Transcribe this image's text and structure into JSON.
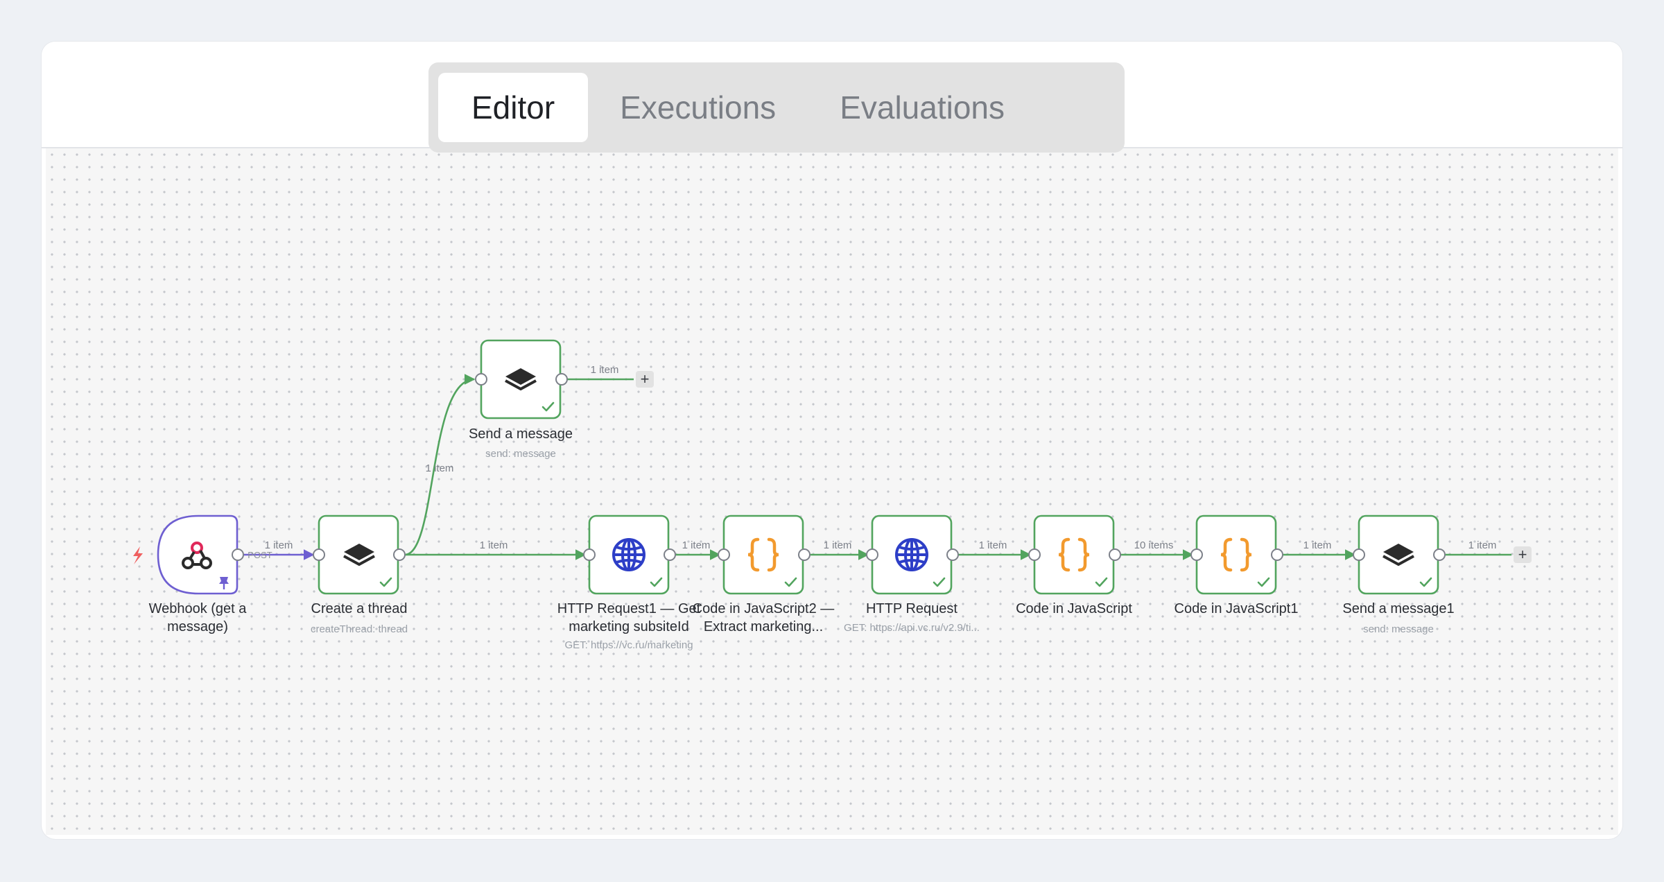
{
  "tabs": [
    {
      "label": "Editor",
      "active": true
    },
    {
      "label": "Executions",
      "active": false
    },
    {
      "label": "Evaluations",
      "active": false
    }
  ],
  "colors": {
    "edge": "#52a45e",
    "trigger_edge": "#6e5fd1",
    "code_icon": "#f29a2e",
    "http_icon": "#2d3ec7",
    "webhook_icon": "#e0295a"
  },
  "nodes": {
    "webhook": {
      "label_1": "Webhook (get a",
      "label_2": "message)",
      "icon": "webhook-icon",
      "method": "POST"
    },
    "create_thread": {
      "label": "Create a thread",
      "sub": "createThread: thread",
      "icon": "layers-icon"
    },
    "send_message": {
      "label": "Send a message",
      "sub": "send: message",
      "icon": "layers-icon"
    },
    "http_request1": {
      "label_1": "HTTP Request1 — Get",
      "label_2": "marketing subsiteId",
      "sub": "GET: https://vc.ru/marketing",
      "icon": "globe-icon"
    },
    "code_js2": {
      "label_1": "Code in JavaScript2 —",
      "label_2": "Extract marketing...",
      "icon": "code-braces-icon"
    },
    "http_request": {
      "label": "HTTP Request",
      "sub": "GET: https://api.vc.ru/v2.9/ti...",
      "icon": "globe-icon"
    },
    "code_js": {
      "label": "Code in JavaScript",
      "icon": "code-braces-icon"
    },
    "code_js1": {
      "label": "Code in JavaScript1",
      "icon": "code-braces-icon"
    },
    "send_message1": {
      "label": "Send a message1",
      "sub": "send: message",
      "icon": "layers-icon"
    }
  },
  "edges": {
    "webhook_create": "1 item",
    "create_send": "1 item",
    "send_out": "1 item",
    "create_http1": "1 item",
    "http1_code2": "1 item",
    "code2_http": "1 item",
    "http_code": "1 item",
    "code_code1": "10 items",
    "code1_send1": "1 item",
    "send1_out": "1 item"
  },
  "add_button_glyph": "+"
}
